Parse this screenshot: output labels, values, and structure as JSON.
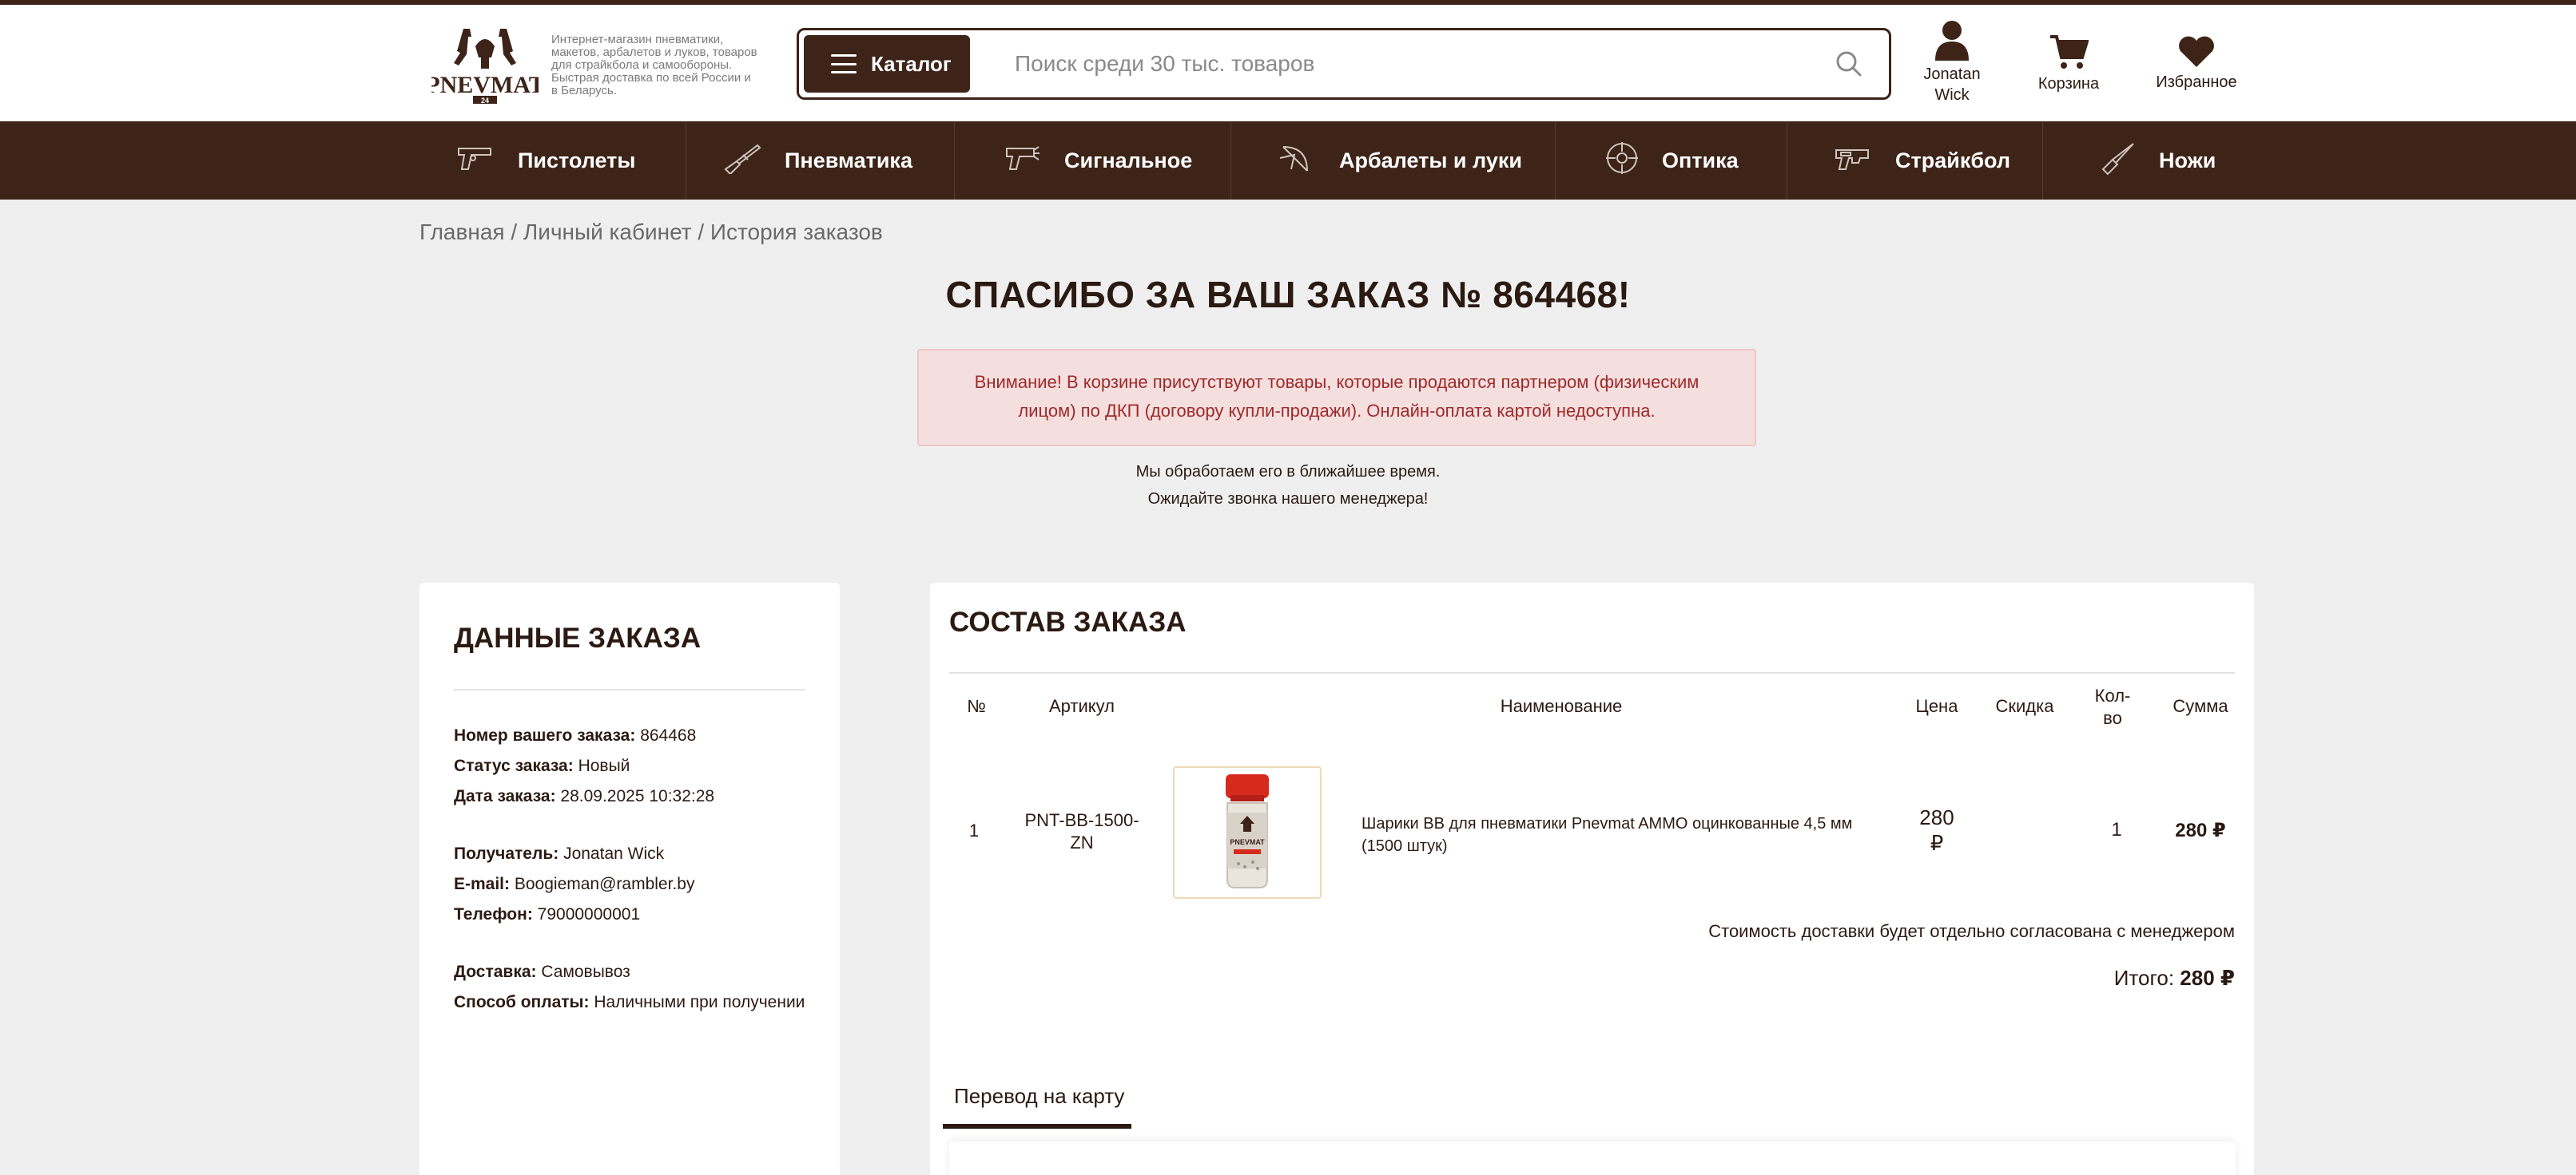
{
  "header": {
    "tagline": "Интернет-магазин пневматики, макетов, арбалетов и луков, товаров для страйкбола и самообороны. Быстрая доставка по всей России и в Беларусь.",
    "catalog_label": "Каталог",
    "search_placeholder": "Поиск среди 30 тыс. товаров",
    "user_line1": "Jonatan",
    "user_line2": "Wick",
    "cart_label": "Корзина",
    "favorites_label": "Избранное",
    "brand_color": "#3d2318"
  },
  "nav": {
    "items": [
      {
        "label": "Пистолеты",
        "icon": "pistol-icon"
      },
      {
        "label": "Пневматика",
        "icon": "air-rifle-icon"
      },
      {
        "label": "Сигнальное",
        "icon": "signal-pistol-icon"
      },
      {
        "label": "Арбалеты и луки",
        "icon": "crossbow-icon"
      },
      {
        "label": "Оптика",
        "icon": "scope-icon"
      },
      {
        "label": "Страйкбол",
        "icon": "airsoft-icon"
      },
      {
        "label": "Ножи",
        "icon": "knife-icon"
      }
    ]
  },
  "breadcrumb": {
    "home": "Главная",
    "sep": " / ",
    "account": "Личный кабинет",
    "current": "История заказов"
  },
  "page": {
    "title": "СПАСИБО ЗА ВАШ ЗАКАЗ № 864468!",
    "alert_line1": "Внимание! В корзине присутствуют товары, которые продаются партнером (физическим",
    "alert_line2": "лицом) по ДКП (договору купли-продажи). Онлайн-оплата картой недоступна.",
    "note1": "Мы обработаем его в ближайшее время.",
    "note2": "Ожидайте звонка нашего менеджера!"
  },
  "order_info": {
    "heading": "ДАННЫЕ ЗАКАЗА",
    "number_label": "Номер вашего заказа:",
    "number": "864468",
    "status_label": "Статус заказа:",
    "status": "Новый",
    "date_label": "Дата заказа:",
    "date": "28.09.2025 10:32:28",
    "recipient_label": "Получатель:",
    "recipient": "Jonatan Wick",
    "email_label": "E-mail:",
    "email": "Boogieman@rambler.by",
    "phone_label": "Телефон:",
    "phone": "79000000001",
    "delivery_label": "Доставка:",
    "delivery": "Самовывоз",
    "payment_label": "Способ оплаты:",
    "payment": "Наличными при получении"
  },
  "order_items": {
    "heading": "СОСТАВ ЗАКАЗА",
    "columns": {
      "num": "№",
      "sku": "Артикул",
      "name": "Наименование",
      "price": "Цена",
      "discount": "Скидка",
      "qty_line1": "Кол-",
      "qty_line2": "во",
      "sum": "Сумма"
    },
    "rows": [
      {
        "num": "1",
        "sku_line1": "PNT-BB-1500-",
        "sku_line2": "ZN",
        "name_line1": "Шарики BB для пневматики Pnevmat AMMO оцинкованные 4,5 мм",
        "name_line2": "(1500 штук)",
        "price_line1": "280",
        "price_line2": "₽",
        "discount": "",
        "qty": "1",
        "sum": "280 ₽"
      }
    ],
    "delivery_note": "Стоимость доставки будет отдельно согласована с менеджером",
    "total_label": "Итого:",
    "total": "280 ₽",
    "tab_label": "Перевод на карту"
  }
}
